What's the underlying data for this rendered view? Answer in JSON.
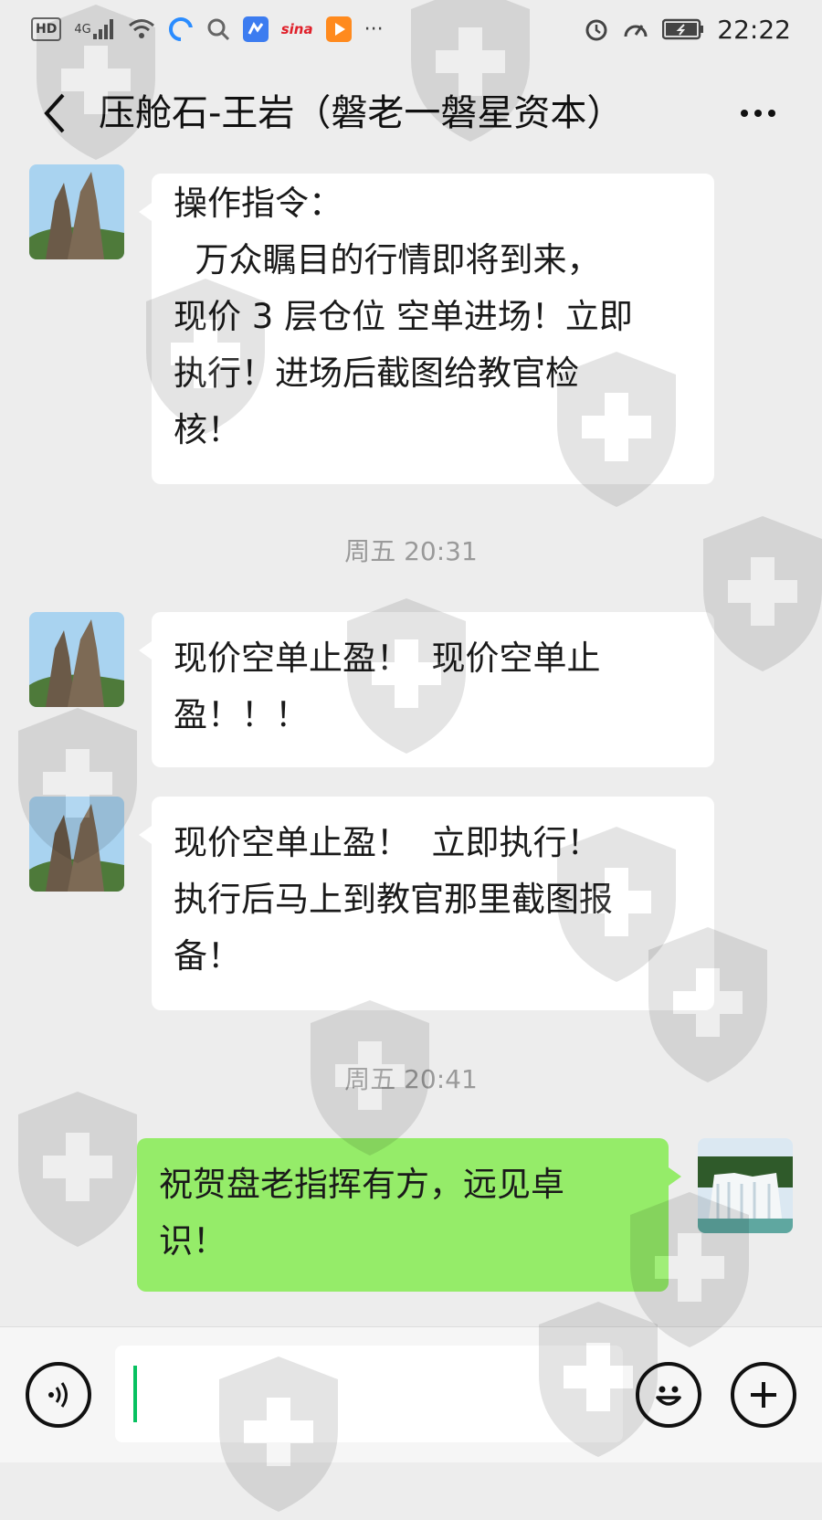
{
  "statusbar": {
    "left_icons": [
      "hd-icon",
      "signal-4g-icon",
      "wifi-icon",
      "app-icon-1",
      "search-icon",
      "app-icon-2",
      "sina-icon",
      "video-app-icon",
      "more-notifications-icon"
    ],
    "hd": "HD",
    "net": "4G",
    "sina": "sina",
    "ellipsis": "···",
    "time": "22:22"
  },
  "header": {
    "title": "压舱石-王岩（磐老一磐星资本）"
  },
  "messages": [
    {
      "side": "left",
      "text": "操作指令：\n  万众瞩目的行情即将到来，\n现价 3 层仓位 空单进场！立即\n执行！进场后截图给教官检\n核！"
    },
    {
      "type": "time",
      "text": "周五 20:31"
    },
    {
      "side": "left",
      "text": "现价空单止盈！  现价空单止\n盈！！！"
    },
    {
      "side": "left",
      "text": "现价空单止盈！  立即执行！\n执行后马上到教官那里截图报\n备！"
    },
    {
      "type": "time",
      "text": "周五 20:41"
    },
    {
      "side": "right",
      "text": "祝贺盘老指挥有方，远见卓\n识！"
    }
  ],
  "colors": {
    "background": "#ededed",
    "bubble_left": "#ffffff",
    "bubble_right": "#95ec69",
    "caret": "#07c160",
    "timestamp": "#9a9a9a"
  },
  "inputbar": {
    "icons": [
      "voice-icon",
      "emoji-icon",
      "plus-icon"
    ],
    "value": ""
  }
}
